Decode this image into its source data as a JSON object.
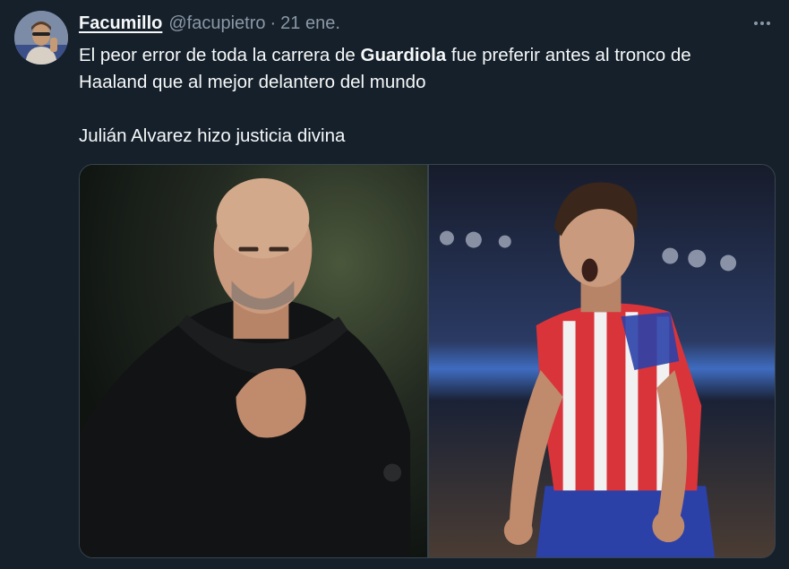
{
  "tweet": {
    "display_name": "Facumillo",
    "handle": "@facupietro",
    "separator": "·",
    "date": "21 ene.",
    "text": {
      "line1_before": "El peor error de toda la carrera de ",
      "line1_bold": "Guardiola",
      "line1_after": " fue preferir antes al tronco de",
      "line2": "Haaland que al mejor delantero del mundo",
      "line3": "Julián Alvarez hizo justicia divina"
    }
  },
  "icons": {
    "more": "more-options-icon"
  },
  "colors": {
    "background": "#15202b",
    "text_primary": "#f7f9f9",
    "text_secondary": "#8b98a5",
    "border": "#38444d"
  }
}
